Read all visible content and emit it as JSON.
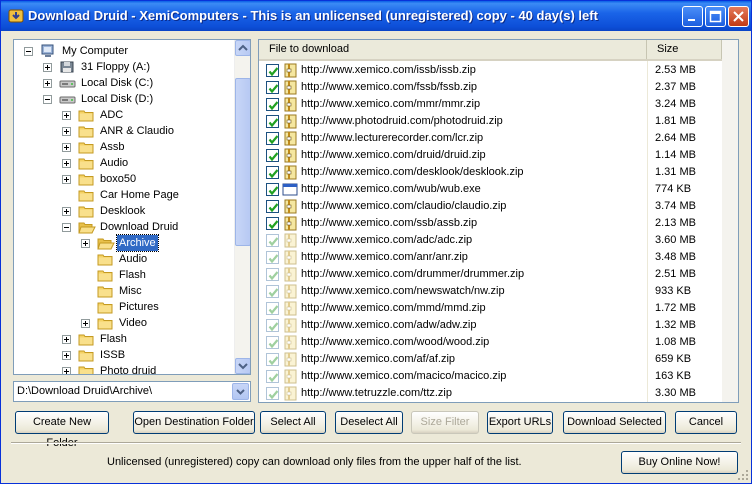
{
  "window": {
    "title": "Download Druid - XemiComputers - This is an unlicensed (unregistered) copy - 40 day(s) left"
  },
  "tree": {
    "items": [
      {
        "label": "My Computer",
        "level": 0,
        "icon": "computer-icon",
        "expander": "minus"
      },
      {
        "label": "31 Floppy (A:)",
        "level": 1,
        "icon": "floppy-icon",
        "expander": "plus"
      },
      {
        "label": "Local Disk (C:)",
        "level": 1,
        "icon": "disk-icon",
        "expander": "plus"
      },
      {
        "label": "Local Disk (D:)",
        "level": 1,
        "icon": "disk-icon",
        "expander": "minus"
      },
      {
        "label": "ADC",
        "level": 2,
        "icon": "folder-icon",
        "expander": "plus"
      },
      {
        "label": "ANR & Claudio",
        "level": 2,
        "icon": "folder-icon",
        "expander": "plus"
      },
      {
        "label": "Assb",
        "level": 2,
        "icon": "folder-icon",
        "expander": "plus"
      },
      {
        "label": "Audio",
        "level": 2,
        "icon": "folder-icon",
        "expander": "plus"
      },
      {
        "label": "boxo50",
        "level": 2,
        "icon": "folder-icon",
        "expander": "plus"
      },
      {
        "label": "Car Home Page",
        "level": 2,
        "icon": "folder-icon",
        "expander": "none"
      },
      {
        "label": "Desklook",
        "level": 2,
        "icon": "folder-icon",
        "expander": "plus"
      },
      {
        "label": "Download Druid",
        "level": 2,
        "icon": "folder-open-icon",
        "expander": "minus"
      },
      {
        "label": "Archive",
        "level": 3,
        "icon": "folder-open-icon",
        "expander": "plus",
        "selected": true
      },
      {
        "label": "Audio",
        "level": 3,
        "icon": "folder-icon",
        "expander": "none"
      },
      {
        "label": "Flash",
        "level": 3,
        "icon": "folder-icon",
        "expander": "none"
      },
      {
        "label": "Misc",
        "level": 3,
        "icon": "folder-icon",
        "expander": "none"
      },
      {
        "label": "Pictures",
        "level": 3,
        "icon": "folder-icon",
        "expander": "none"
      },
      {
        "label": "Video",
        "level": 3,
        "icon": "folder-icon",
        "expander": "plus"
      },
      {
        "label": "Flash",
        "level": 2,
        "icon": "folder-icon",
        "expander": "plus"
      },
      {
        "label": "ISSB",
        "level": 2,
        "icon": "folder-icon",
        "expander": "plus"
      },
      {
        "label": "Photo druid",
        "level": 2,
        "icon": "folder-icon",
        "expander": "plus"
      }
    ]
  },
  "path_combo": {
    "value": "D:\\Download Druid\\Archive\\"
  },
  "file_list": {
    "headers": {
      "file": "File to download",
      "size": "Size"
    },
    "rows": [
      {
        "url": "http://www.xemico.com/issb/issb.zip",
        "size": "2.53 MB",
        "enabled": true,
        "icon": "zip-icon"
      },
      {
        "url": "http://www.xemico.com/fssb/fssb.zip",
        "size": "2.37 MB",
        "enabled": true,
        "icon": "zip-icon"
      },
      {
        "url": "http://www.xemico.com/mmr/mmr.zip",
        "size": "3.24 MB",
        "enabled": true,
        "icon": "zip-icon"
      },
      {
        "url": "http://www.photodruid.com/photodruid.zip",
        "size": "1.81 MB",
        "enabled": true,
        "icon": "zip-icon"
      },
      {
        "url": "http://www.lecturerecorder.com/lcr.zip",
        "size": "2.64 MB",
        "enabled": true,
        "icon": "zip-icon"
      },
      {
        "url": "http://www.xemico.com/druid/druid.zip",
        "size": "1.14 MB",
        "enabled": true,
        "icon": "zip-icon"
      },
      {
        "url": "http://www.xemico.com/desklook/desklook.zip",
        "size": "1.31 MB",
        "enabled": true,
        "icon": "zip-icon"
      },
      {
        "url": "http://www.xemico.com/wub/wub.exe",
        "size": "774 KB",
        "enabled": true,
        "icon": "exe-icon"
      },
      {
        "url": "http://www.xemico.com/claudio/claudio.zip",
        "size": "3.74 MB",
        "enabled": true,
        "icon": "zip-icon"
      },
      {
        "url": "http://www.xemico.com/ssb/assb.zip",
        "size": "2.13 MB",
        "enabled": true,
        "icon": "zip-icon"
      },
      {
        "url": "http://www.xemico.com/adc/adc.zip",
        "size": "3.60 MB",
        "enabled": false,
        "icon": "zip-icon"
      },
      {
        "url": "http://www.xemico.com/anr/anr.zip",
        "size": "3.48 MB",
        "enabled": false,
        "icon": "zip-icon"
      },
      {
        "url": "http://www.xemico.com/drummer/drummer.zip",
        "size": "2.51 MB",
        "enabled": false,
        "icon": "zip-icon"
      },
      {
        "url": "http://www.xemico.com/newswatch/nw.zip",
        "size": "933 KB",
        "enabled": false,
        "icon": "zip-icon"
      },
      {
        "url": "http://www.xemico.com/mmd/mmd.zip",
        "size": "1.72 MB",
        "enabled": false,
        "icon": "zip-icon"
      },
      {
        "url": "http://www.xemico.com/adw/adw.zip",
        "size": "1.32 MB",
        "enabled": false,
        "icon": "zip-icon"
      },
      {
        "url": "http://www.xemico.com/wood/wood.zip",
        "size": "1.08 MB",
        "enabled": false,
        "icon": "zip-icon"
      },
      {
        "url": "http://www.xemico.com/af/af.zip",
        "size": "659 KB",
        "enabled": false,
        "icon": "zip-icon"
      },
      {
        "url": "http://www.xemico.com/macico/macico.zip",
        "size": "163 KB",
        "enabled": false,
        "icon": "zip-icon"
      },
      {
        "url": "http://www.tetruzzle.com/ttz.zip",
        "size": "3.30 MB",
        "enabled": false,
        "icon": "zip-icon"
      }
    ]
  },
  "buttons": {
    "create_folder": "Create New Folder",
    "open_dest": "Open Destination Folder",
    "select_all": "Select All",
    "deselect_all": "Deselect All",
    "size_filter": "Size Filter",
    "export_urls": "Export URLs",
    "download_selected": "Download Selected",
    "cancel": "Cancel",
    "buy_online": "Buy Online Now!"
  },
  "status": {
    "notice": "Unlicensed (unregistered) copy can download only files from the upper half of the list."
  },
  "colors": {
    "titlebar": "#0a5fe6",
    "selection": "#316ac5",
    "folder": "#f5d264"
  }
}
